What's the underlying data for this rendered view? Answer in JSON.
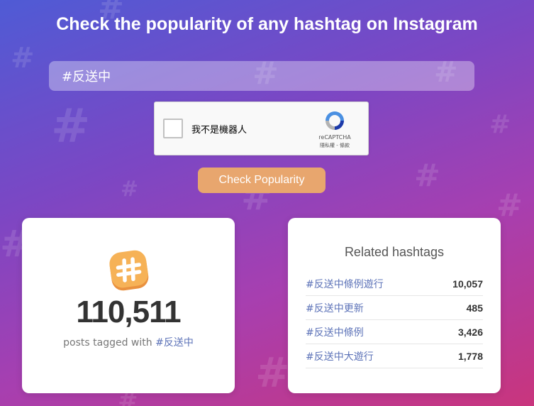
{
  "header": {
    "title": "Check the popularity of any hashtag on Instagram"
  },
  "search": {
    "value": "#反送中"
  },
  "captcha": {
    "label": "我不是機器人",
    "brand": "reCAPTCHA",
    "links": "隱私權 - 條款"
  },
  "actions": {
    "check_label": "Check Popularity"
  },
  "result": {
    "count": "110,511",
    "caption_prefix": "posts tagged with ",
    "caption_tag": "#反送中"
  },
  "related": {
    "title": "Related hashtags",
    "items": [
      {
        "tag": "#反送中條例遊行",
        "count": "10,057"
      },
      {
        "tag": "#反送中更新",
        "count": "485"
      },
      {
        "tag": "#反送中條例",
        "count": "3,426"
      },
      {
        "tag": "#反送中大遊行",
        "count": "1,778"
      }
    ]
  },
  "colors": {
    "accent_button": "#e8a66e",
    "tag_link": "#5d73b8",
    "background_start": "#4f5bd5",
    "background_end": "#c9357d"
  },
  "icons": {
    "badge": "hashtag-icon",
    "captcha": "recaptcha-icon"
  }
}
